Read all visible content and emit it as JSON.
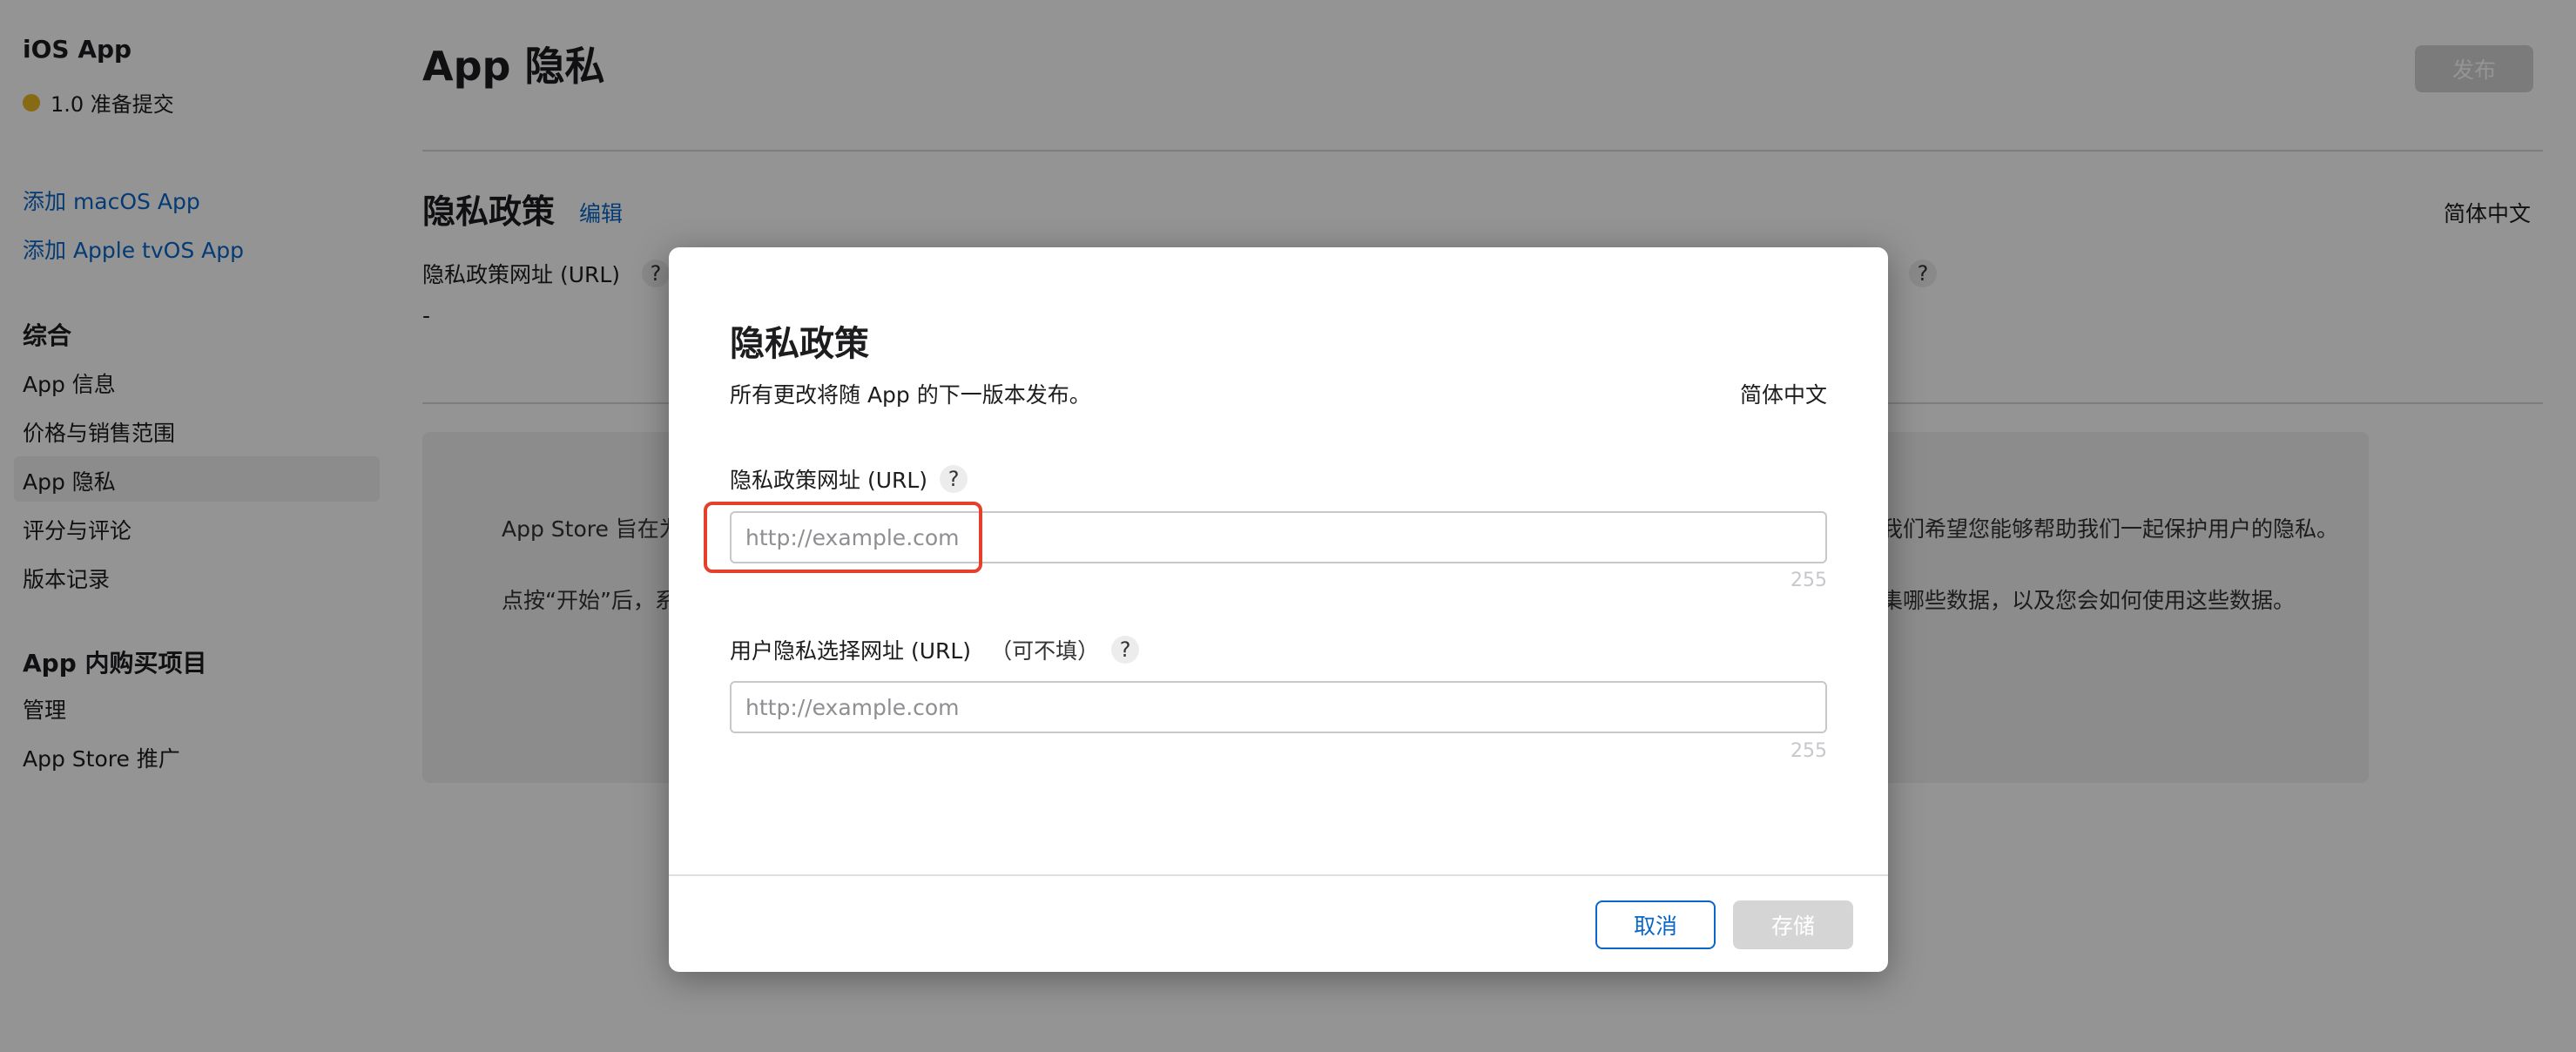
{
  "sidebar": {
    "app_title": "iOS App",
    "status_text": "1.0 准备提交",
    "status_color": "#e8b823",
    "links": [
      "添加 macOS App",
      "添加 Apple tvOS App"
    ],
    "section_general": "综合",
    "general_items": [
      "App 信息",
      "价格与销售范围",
      "App 隐私",
      "评分与评论",
      "版本记录"
    ],
    "selected_item": "App 隐私",
    "section_iap": "App 内购买项目",
    "iap_items": [
      "管理",
      "App Store 推广"
    ]
  },
  "main": {
    "page_title": "App 隐私",
    "publish_label": "发布",
    "section_title": "隐私政策",
    "edit_label": "编辑",
    "language": "简体中文",
    "field_label": "隐私政策网址 (URL)",
    "field_value": "-",
    "info_line1_left": "App Store 旨在为",
    "info_line1_right": "我们希望您能够帮助我们一起保护用户的隐私。",
    "info_line2_left": "点按“开始”后，系",
    "info_line2_right": "集哪些数据，以及您会如何使用这些数据。"
  },
  "modal": {
    "title": "隐私政策",
    "subtitle": "所有更改将随 App 的下一版本发布。",
    "language": "简体中文",
    "field1": {
      "label": "隐私政策网址 (URL)",
      "placeholder": "http://example.com",
      "counter": "255"
    },
    "field2": {
      "label": "用户隐私选择网址 (URL)",
      "optional": "（可不填）",
      "placeholder": "http://example.com",
      "counter": "255"
    },
    "help_glyph": "?",
    "cancel_label": "取消",
    "save_label": "存储"
  },
  "colors": {
    "link": "#0a66c8",
    "highlight": "#e5402b",
    "disabled_button": "#d5d5d5"
  }
}
